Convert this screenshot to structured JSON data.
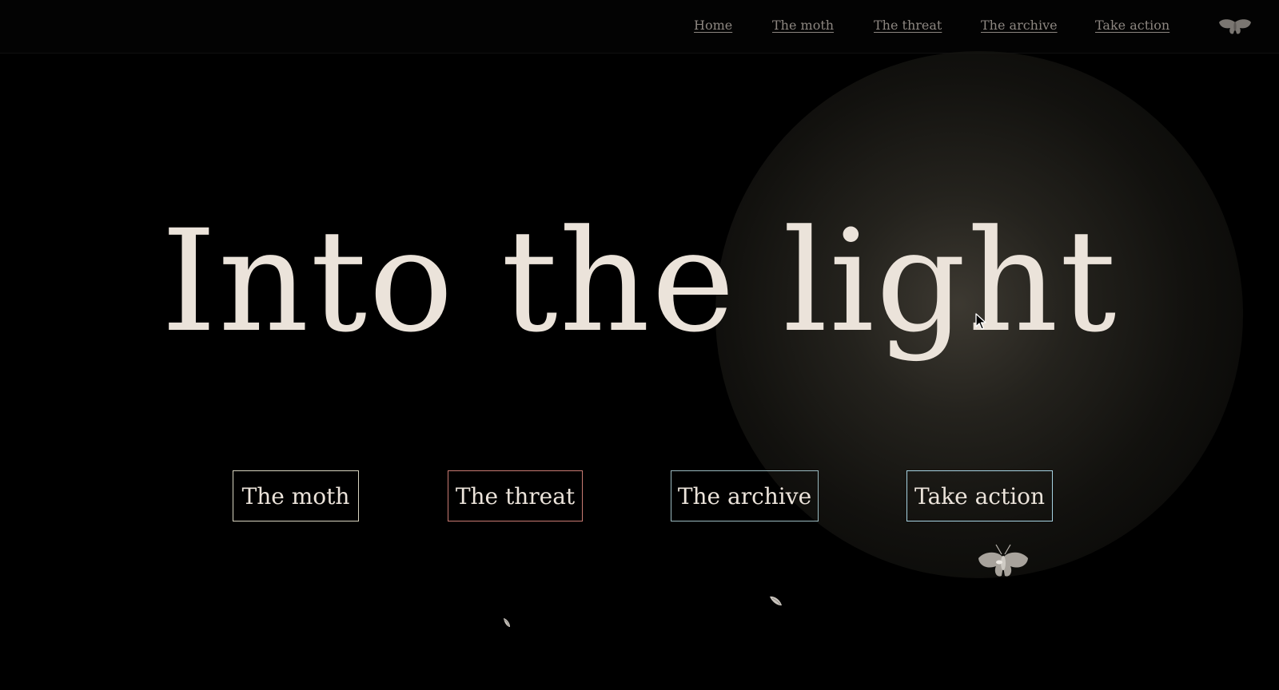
{
  "nav": {
    "links": [
      {
        "label": "Home"
      },
      {
        "label": "The moth"
      },
      {
        "label": "The threat"
      },
      {
        "label": "The archive"
      },
      {
        "label": "Take action"
      }
    ],
    "logo_icon": "moth-icon"
  },
  "hero": {
    "title": "Into the light"
  },
  "cta": {
    "moth": {
      "label": "The moth",
      "border_color": "#d8d4c0"
    },
    "threat": {
      "label": "The threat",
      "border_color": "#c97a72"
    },
    "archive": {
      "label": "The archive",
      "border_color": "#9ab9bf"
    },
    "action": {
      "label": "Take action",
      "border_color": "#a6d2e1"
    }
  },
  "colors": {
    "background": "#000000",
    "text": "#ebe3da",
    "nav_text": "#8c8680",
    "glow": "#403c34"
  },
  "icons": [
    "moth-icon",
    "mouse-cursor-icon"
  ]
}
